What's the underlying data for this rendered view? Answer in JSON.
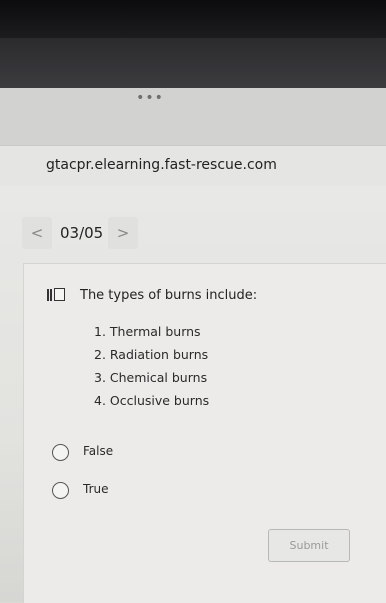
{
  "browser": {
    "menu_dots": "•••",
    "url": "gtacpr.elearning.fast-rescue.com"
  },
  "pager": {
    "prev_icon": "chevron-left-icon",
    "prev_glyph": "<",
    "page_label": "03/05",
    "next_icon": "chevron-right-icon",
    "next_glyph": ">"
  },
  "question": {
    "flag_icon": "flag-icon",
    "text": "The types of burns include:",
    "items": [
      "1.  Thermal burns",
      "2.  Radiation burns",
      "3.  Chemical burns",
      "4.  Occlusive burns"
    ]
  },
  "options": [
    {
      "label": "False",
      "selected": false
    },
    {
      "label": "True",
      "selected": false
    }
  ],
  "submit_label": "Submit"
}
